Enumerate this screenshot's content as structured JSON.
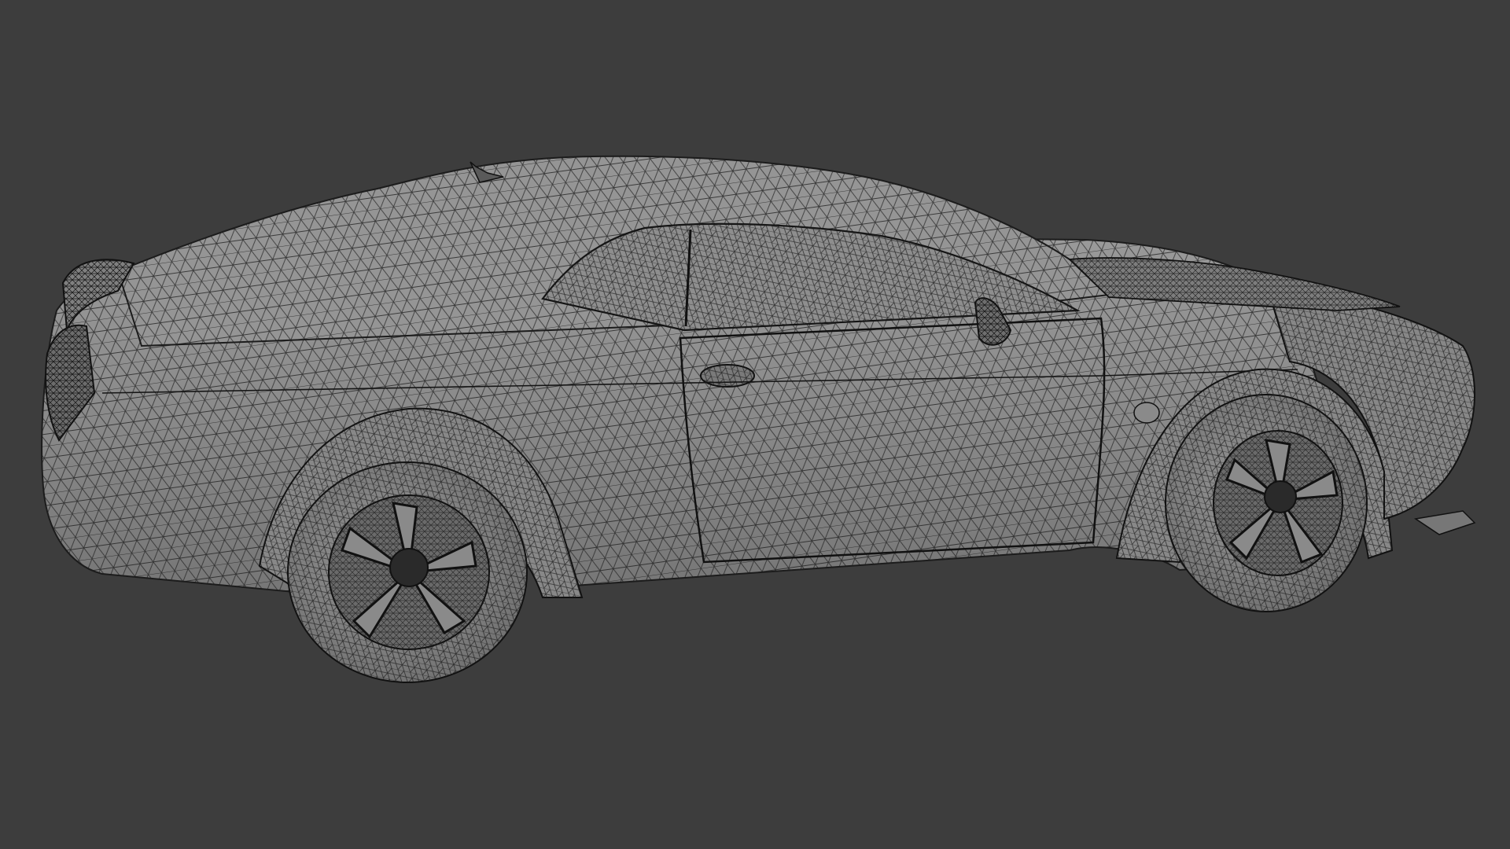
{
  "viewport": {
    "background_color": "#3d3d3d",
    "shading_mode": "solid",
    "wireframe_overlay": true,
    "object": "car-model"
  },
  "colors": {
    "surface": "#8c8c8c",
    "surface_light": "#a2a2a2",
    "surface_dark": "#6f6f6f",
    "wire": "#1c1c1c",
    "tire": "#7e7e7e",
    "rim_dark": "#2a2a2a"
  }
}
